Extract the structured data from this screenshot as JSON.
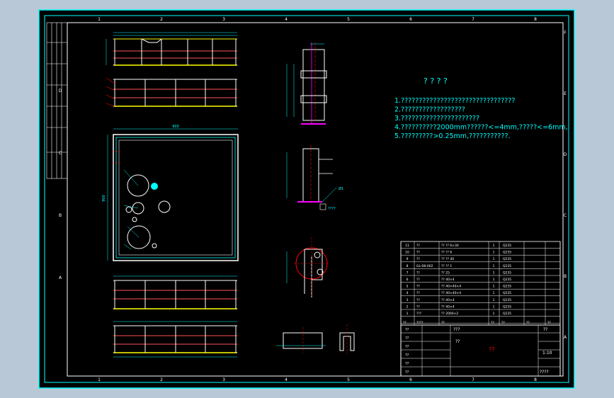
{
  "notes": {
    "heading": "? ? ? ?",
    "lines": [
      "1.????????????????????????????????",
      "2.??????????????????",
      "3.??????????????????????",
      "4.??????????2000mm??????<=4mm,?????<=6mm,",
      "5.?????????>0.25mm,???????????."
    ]
  },
  "border_numbers": {
    "top": [
      "1",
      "2",
      "3",
      "4",
      "5",
      "6",
      "7",
      "8"
    ],
    "bottom": [
      "1",
      "2",
      "3",
      "4",
      "5",
      "6",
      "7",
      "8"
    ],
    "left": [
      "D",
      "C",
      "B",
      "A"
    ],
    "right": [
      "F",
      "E",
      "D",
      "C",
      "B",
      "A"
    ]
  },
  "dimension_labels": {
    "plate_width": "900",
    "plate_height": "900",
    "side_callout": "????",
    "shaft_callout": "Ø1"
  },
  "bom": {
    "rows": [
      {
        "no": "11",
        "code": "??",
        "name": "?? ?? 6×30",
        "qty": "1",
        "mat": "Q235"
      },
      {
        "no": "10",
        "code": "??",
        "name": "?? ?? 6",
        "qty": "1",
        "mat": "Q235"
      },
      {
        "no": "9",
        "code": "??",
        "name": "?? ?? 40",
        "qty": "1",
        "mat": "Q235"
      },
      {
        "no": "8",
        "code": "GL-08-002",
        "name": "?? ?? 1",
        "qty": "1",
        "mat": "Q235"
      },
      {
        "no": "7",
        "code": "??",
        "name": "?? 25",
        "qty": "1",
        "mat": "Q235"
      },
      {
        "no": "6",
        "code": "??",
        "name": "?? 40×4",
        "qty": "1",
        "mat": "Q235"
      },
      {
        "no": "5",
        "code": "??",
        "name": "?? 40×40×4",
        "qty": "1",
        "mat": "Q235"
      },
      {
        "no": "4",
        "code": "??",
        "name": "?? 40×40×4",
        "qty": "1",
        "mat": "Q235"
      },
      {
        "no": "3",
        "code": "??",
        "name": "?? 40×4",
        "qty": "1",
        "mat": "Q235"
      },
      {
        "no": "2",
        "code": "??",
        "name": "?? 40×4",
        "qty": "1",
        "mat": "Q235"
      },
      {
        "no": "1",
        "code": "???",
        "name": "?? 2000×2",
        "qty": "1",
        "mat": "Q235"
      }
    ],
    "header": [
      "??",
      "????",
      "??",
      "??",
      "??",
      "??",
      "??"
    ]
  },
  "title_block": {
    "labels": [
      "??",
      "??",
      "??",
      "??",
      "??",
      "??"
    ],
    "drawing_title": "???",
    "company": "??",
    "sheet": "??",
    "scale_label": "??",
    "ratio": "1:10",
    "sheet_count": "????"
  },
  "colors": {
    "background": "#000000",
    "frame": "#ffffff",
    "dimension": "#00ffff",
    "part": "#ffff00",
    "red": "#ff0000",
    "green": "#00ff00",
    "magenta": "#ff00ff",
    "label": "#ff5555"
  }
}
